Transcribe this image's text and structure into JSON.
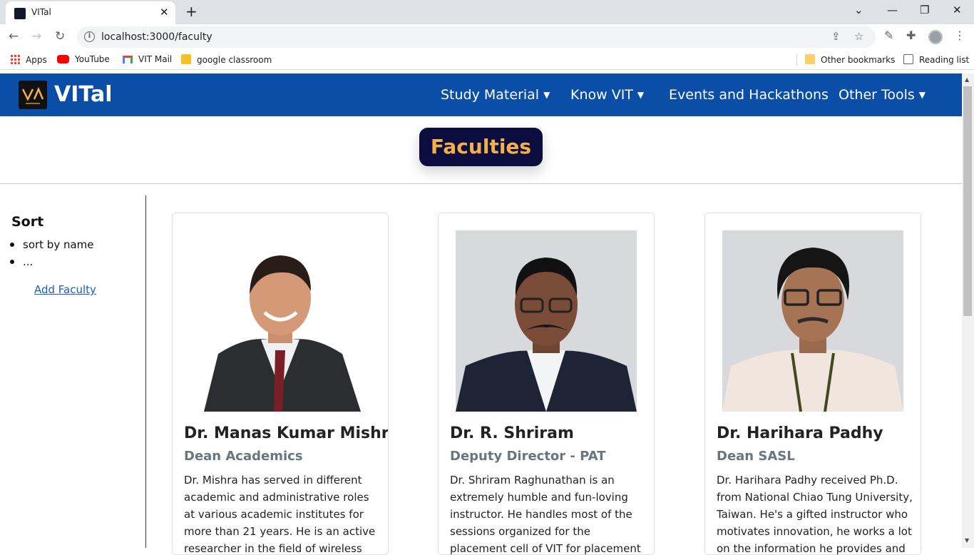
{
  "browser": {
    "tab_title": "VITal",
    "url": "localhost:3000/faculty",
    "bookmarks": [
      "Apps",
      "YouTube",
      "VIT Mail",
      "google classroom"
    ],
    "other_bookmarks": "Other bookmarks",
    "reading_list": "Reading list"
  },
  "navbar": {
    "brand": "VITal",
    "links": [
      {
        "label": "Study Material",
        "dropdown": true
      },
      {
        "label": "Know VIT",
        "dropdown": true
      },
      {
        "label": "Events and Hackathons",
        "dropdown": false
      },
      {
        "label": "Other Tools",
        "dropdown": true
      }
    ]
  },
  "page": {
    "title": "Faculties",
    "sort": {
      "title": "Sort",
      "items": [
        "sort by name",
        "..."
      ],
      "add_link": "Add Faculty"
    }
  },
  "faculty": [
    {
      "name": "Dr. Manas Kumar Mishra",
      "role": "Dean Academics",
      "desc": "Dr. Mishra has served in different academic and administrative roles at various academic institutes for more than 21 years. He is an active researcher in the field of wireless"
    },
    {
      "name": "Dr. R. Shriram",
      "role": "Deputy Director - PAT",
      "desc": "Dr. Shriram Raghunathan is an extremely humble and fun-loving instructor. He handles most of the sessions organized for the placement cell of VIT for placement guidance"
    },
    {
      "name": "Dr. Harihara Padhy",
      "role": "Dean SASL",
      "desc": "Dr. Harihara Padhy received Ph.D. from National Chiao Tung University, Taiwan. He's a gifted instructor who motivates innovation, he works a lot on the information he provides and"
    }
  ],
  "colors": {
    "navbar": "#0a4ea7",
    "title_box": "#0a0d3d",
    "title_text": "#f2b04d",
    "link": "#1a5fc4"
  }
}
